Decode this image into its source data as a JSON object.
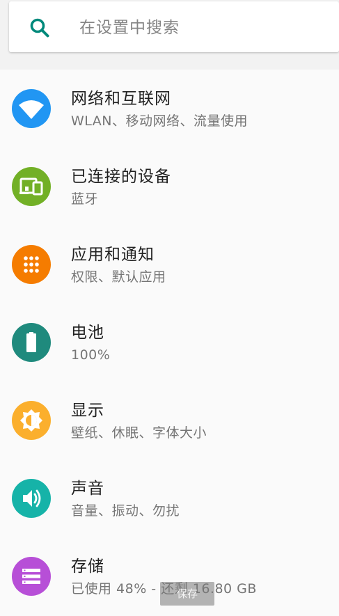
{
  "search": {
    "placeholder": "在设置中搜索",
    "icon": "search-icon"
  },
  "items": [
    {
      "title": "网络和互联网",
      "subtitle": "WLAN、移动网络、流量使用",
      "icon": "wifi-icon",
      "color": "#2196f3"
    },
    {
      "title": "已连接的设备",
      "subtitle": "蓝牙",
      "icon": "devices-icon",
      "color": "#72b026"
    },
    {
      "title": "应用和通知",
      "subtitle": "权限、默认应用",
      "icon": "apps-icon",
      "color": "#f57c00"
    },
    {
      "title": "电池",
      "subtitle": "100%",
      "icon": "battery-icon",
      "color": "#1f8a7d"
    },
    {
      "title": "显示",
      "subtitle": "壁纸、休眠、字体大小",
      "icon": "brightness-icon",
      "color": "#fbaf2d"
    },
    {
      "title": "声音",
      "subtitle": "音量、振动、勿扰",
      "icon": "volume-icon",
      "color": "#16b3a8"
    },
    {
      "title": "存储",
      "subtitle": "已使用 48% - 还剩 16.80 GB",
      "icon": "storage-icon",
      "color": "#b74fd7"
    }
  ],
  "toast": {
    "text": "保存"
  },
  "colors": {
    "accent": "#00897b"
  }
}
